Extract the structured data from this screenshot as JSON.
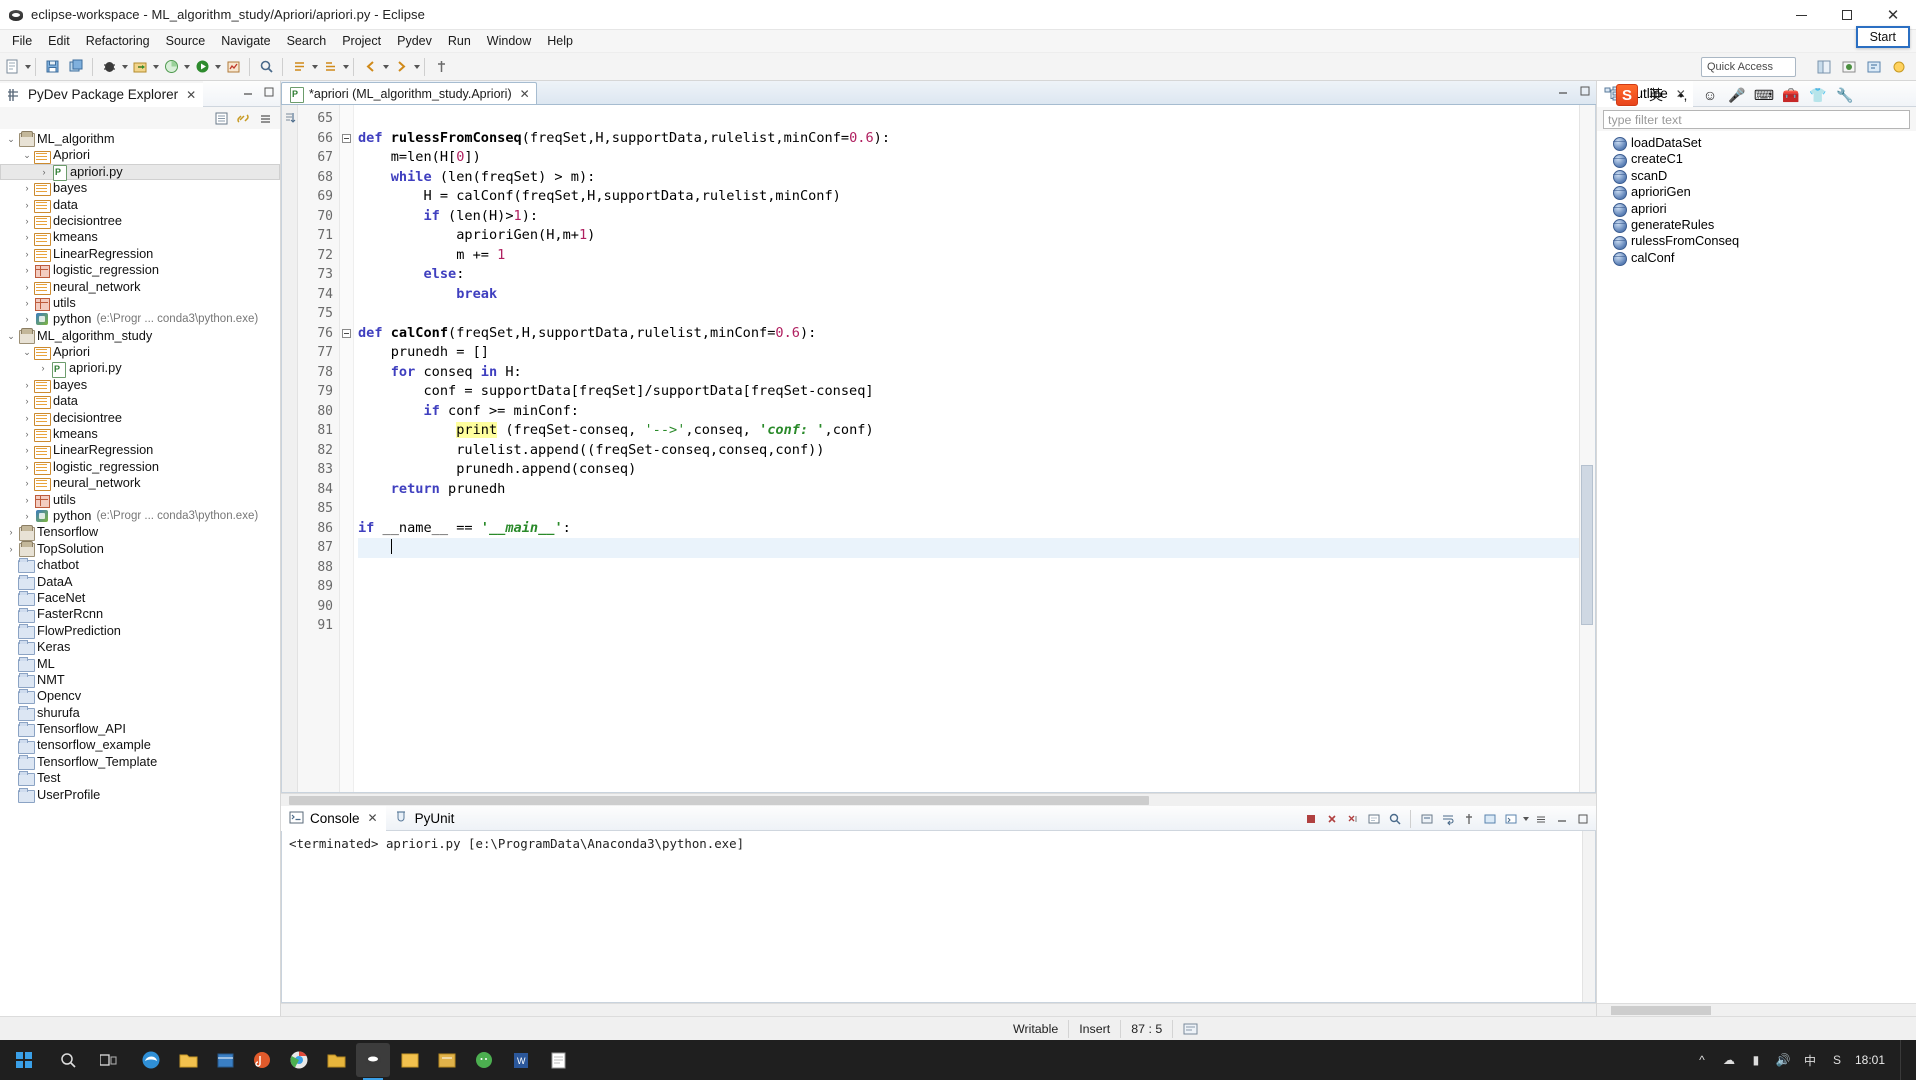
{
  "window": {
    "title": "eclipse-workspace - ML_algorithm_study/Apriori/apriori.py - Eclipse",
    "minimize": "–",
    "maximize": "□",
    "close": "✕"
  },
  "menubar": [
    "File",
    "Edit",
    "Refactoring",
    "Source",
    "Navigate",
    "Search",
    "Project",
    "Pydev",
    "Run",
    "Window",
    "Help"
  ],
  "toolbar": {
    "quick_access": "Quick Access"
  },
  "explorer": {
    "tab_label": "PyDev Package Explorer",
    "tree": [
      {
        "indent": 0,
        "twist": "v",
        "icon": "project",
        "label": "ML_algorithm",
        "dim": ""
      },
      {
        "indent": 1,
        "twist": "v",
        "icon": "srcfolder",
        "label": "Apriori",
        "dim": ""
      },
      {
        "indent": 2,
        "twist": ">",
        "icon": "py",
        "label": "apriori.py",
        "dim": "",
        "selected": true
      },
      {
        "indent": 1,
        "twist": ">",
        "icon": "srcfolder",
        "label": "bayes",
        "dim": ""
      },
      {
        "indent": 1,
        "twist": ">",
        "icon": "srcfolder",
        "label": "data",
        "dim": ""
      },
      {
        "indent": 1,
        "twist": ">",
        "icon": "srcfolder",
        "label": "decisiontree",
        "dim": ""
      },
      {
        "indent": 1,
        "twist": ">",
        "icon": "srcfolder",
        "label": "kmeans",
        "dim": ""
      },
      {
        "indent": 1,
        "twist": ">",
        "icon": "srcfolder",
        "label": "LinearRegression",
        "dim": ""
      },
      {
        "indent": 1,
        "twist": ">",
        "icon": "grid",
        "label": "logistic_regression",
        "dim": ""
      },
      {
        "indent": 1,
        "twist": ">",
        "icon": "srcfolder",
        "label": "neural_network",
        "dim": ""
      },
      {
        "indent": 1,
        "twist": ">",
        "icon": "grid",
        "label": "utils",
        "dim": ""
      },
      {
        "indent": 1,
        "twist": ">",
        "icon": "lib",
        "label": "python",
        "dim": "(e:\\Progr ... conda3\\python.exe)"
      },
      {
        "indent": 0,
        "twist": "v",
        "icon": "project",
        "label": "ML_algorithm_study",
        "dim": ""
      },
      {
        "indent": 1,
        "twist": "v",
        "icon": "srcfolder",
        "label": "Apriori",
        "dim": ""
      },
      {
        "indent": 2,
        "twist": ">",
        "icon": "py",
        "label": "apriori.py",
        "dim": ""
      },
      {
        "indent": 1,
        "twist": ">",
        "icon": "srcfolder",
        "label": "bayes",
        "dim": ""
      },
      {
        "indent": 1,
        "twist": ">",
        "icon": "srcfolder",
        "label": "data",
        "dim": ""
      },
      {
        "indent": 1,
        "twist": ">",
        "icon": "srcfolder",
        "label": "decisiontree",
        "dim": ""
      },
      {
        "indent": 1,
        "twist": ">",
        "icon": "srcfolder",
        "label": "kmeans",
        "dim": ""
      },
      {
        "indent": 1,
        "twist": ">",
        "icon": "srcfolder",
        "label": "LinearRegression",
        "dim": ""
      },
      {
        "indent": 1,
        "twist": ">",
        "icon": "srcfolder",
        "label": "logistic_regression",
        "dim": ""
      },
      {
        "indent": 1,
        "twist": ">",
        "icon": "srcfolder",
        "label": "neural_network",
        "dim": ""
      },
      {
        "indent": 1,
        "twist": ">",
        "icon": "grid",
        "label": "utils",
        "dim": ""
      },
      {
        "indent": 1,
        "twist": ">",
        "icon": "lib",
        "label": "python",
        "dim": "(e:\\Progr ... conda3\\python.exe)"
      },
      {
        "indent": 0,
        "twist": ">",
        "icon": "project",
        "label": "Tensorflow",
        "dim": ""
      },
      {
        "indent": 0,
        "twist": ">",
        "icon": "project",
        "label": "TopSolution",
        "dim": ""
      },
      {
        "indent": 0,
        "twist": "",
        "icon": "plainfolder",
        "label": "chatbot",
        "dim": ""
      },
      {
        "indent": 0,
        "twist": "",
        "icon": "plainfolder",
        "label": "DataA",
        "dim": ""
      },
      {
        "indent": 0,
        "twist": "",
        "icon": "plainfolder",
        "label": "FaceNet",
        "dim": ""
      },
      {
        "indent": 0,
        "twist": "",
        "icon": "plainfolder",
        "label": "FasterRcnn",
        "dim": ""
      },
      {
        "indent": 0,
        "twist": "",
        "icon": "plainfolder",
        "label": "FlowPrediction",
        "dim": ""
      },
      {
        "indent": 0,
        "twist": "",
        "icon": "plainfolder",
        "label": "Keras",
        "dim": ""
      },
      {
        "indent": 0,
        "twist": "",
        "icon": "plainfolder",
        "label": "ML",
        "dim": ""
      },
      {
        "indent": 0,
        "twist": "",
        "icon": "plainfolder",
        "label": "NMT",
        "dim": ""
      },
      {
        "indent": 0,
        "twist": "",
        "icon": "plainfolder",
        "label": "Opencv",
        "dim": ""
      },
      {
        "indent": 0,
        "twist": "",
        "icon": "plainfolder",
        "label": "shurufa",
        "dim": ""
      },
      {
        "indent": 0,
        "twist": "",
        "icon": "plainfolder",
        "label": "Tensorflow_API",
        "dim": ""
      },
      {
        "indent": 0,
        "twist": "",
        "icon": "plainfolder",
        "label": "tensorflow_example",
        "dim": ""
      },
      {
        "indent": 0,
        "twist": "",
        "icon": "plainfolder",
        "label": "Tensorflow_Template",
        "dim": ""
      },
      {
        "indent": 0,
        "twist": "",
        "icon": "plainfolder",
        "label": "Test",
        "dim": ""
      },
      {
        "indent": 0,
        "twist": "",
        "icon": "plainfolder",
        "label": "UserProfile",
        "dim": ""
      }
    ]
  },
  "editor": {
    "tab_label": "*apriori (ML_algorithm_study.Apriori)",
    "first_line": 65,
    "cursor_line": 87,
    "lines": [
      {
        "n": 65,
        "html": ""
      },
      {
        "n": 66,
        "fold": true,
        "html": "<span class=\"kw\">def</span> <span class=\"fn\">rulessFromConseq</span>(freqSet,H,supportData,rulelist,minConf=<span class=\"num\">0.6</span>):"
      },
      {
        "n": 67,
        "html": "    m=len(H[<span class=\"num\">0</span>])"
      },
      {
        "n": 68,
        "html": "    <span class=\"kw\">while</span> (len(freqSet) &gt; m):"
      },
      {
        "n": 69,
        "html": "        H = calConf(freqSet,H,supportData,rulelist,minConf)"
      },
      {
        "n": 70,
        "html": "        <span class=\"kw\">if</span> (len(H)&gt;<span class=\"num\">1</span>):"
      },
      {
        "n": 71,
        "html": "            aprioriGen(H,m+<span class=\"num\">1</span>)"
      },
      {
        "n": 72,
        "html": "            m += <span class=\"num\">1</span>"
      },
      {
        "n": 73,
        "html": "        <span class=\"kw\">else</span>:"
      },
      {
        "n": 74,
        "html": "            <span class=\"kw\">break</span>"
      },
      {
        "n": 75,
        "html": ""
      },
      {
        "n": 76,
        "fold": true,
        "html": "<span class=\"kw\">def</span> <span class=\"fn\">calConf</span>(freqSet,H,supportData,rulelist,minConf=<span class=\"num\">0.6</span>):"
      },
      {
        "n": 77,
        "html": "    prunedh = []"
      },
      {
        "n": 78,
        "html": "    <span class=\"kw\">for</span> conseq <span class=\"kw\">in</span> H:"
      },
      {
        "n": 79,
        "html": "        conf = supportData[freqSet]/supportData[freqSet-conseq]"
      },
      {
        "n": 80,
        "html": "        <span class=\"kw\">if</span> conf &gt;= minConf:"
      },
      {
        "n": 81,
        "html": "            <span class=\"hl\">print</span> (freqSet-conseq, <span class=\"str\">'--&gt;'</span>,conseq, <span class=\"strit\">'conf: '</span>,conf)"
      },
      {
        "n": 82,
        "html": "            rulelist.append((freqSet-conseq,conseq,conf))"
      },
      {
        "n": 83,
        "html": "            prunedh.append(conseq)"
      },
      {
        "n": 84,
        "html": "    <span class=\"kw\">return</span> prunedh"
      },
      {
        "n": 85,
        "html": ""
      },
      {
        "n": 86,
        "html": "<span class=\"kw\">if</span> __name__ == <span class=\"dunder\">'__main__'</span>:"
      },
      {
        "n": 87,
        "cur": true,
        "html": "    <span class=\"caret-bar\"></span>"
      },
      {
        "n": 88,
        "html": ""
      },
      {
        "n": 89,
        "html": ""
      },
      {
        "n": 90,
        "html": ""
      },
      {
        "n": 91,
        "html": ""
      }
    ]
  },
  "console": {
    "tabs": [
      {
        "label": "Console",
        "active": true,
        "closable": true
      },
      {
        "label": "PyUnit",
        "active": false,
        "closable": false
      }
    ],
    "output": "<terminated> apriori.py [e:\\ProgramData\\Anaconda3\\python.exe]"
  },
  "outline": {
    "tab_label": "Outline",
    "filter_placeholder": "type filter text",
    "items": [
      "loadDataSet",
      "createC1",
      "scanD",
      "aprioriGen",
      "apriori",
      "generateRules",
      "rulessFromConseq",
      "calConf"
    ]
  },
  "ime": {
    "logo": "S",
    "lang": "英",
    "start_tooltip": "Start"
  },
  "statusbar": {
    "writable": "Writable",
    "insert": "Insert",
    "position": "87 : 5"
  },
  "taskbar": {
    "clock_time": "18:01"
  },
  "colors": {
    "accent": "#3aa0e8",
    "keyword": "#3f3fbf",
    "string": "#2a8a2a",
    "number": "#b02060",
    "highlight": "#ffff9e",
    "selection": "#eaf3fb"
  }
}
